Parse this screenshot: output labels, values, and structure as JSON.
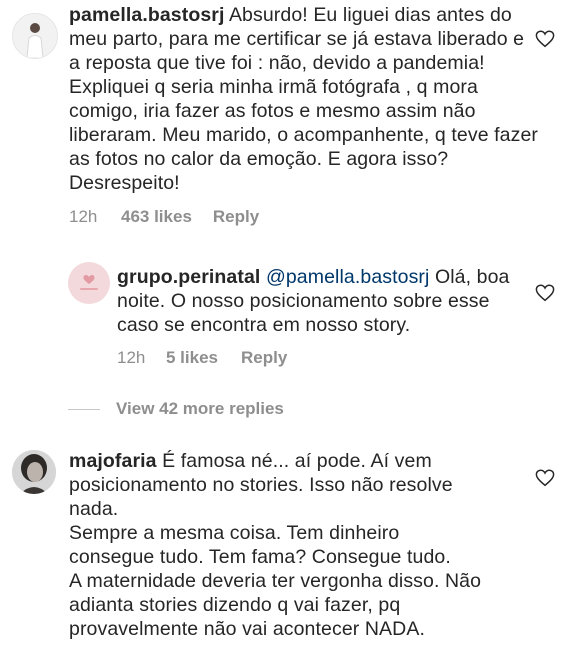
{
  "comments": [
    {
      "username": "pamella.bastosrj",
      "text": "Absurdo! Eu liguei dias antes do meu parto, para me certificar se já estava liberado e a reposta que tive foi : não, devido a pandemia! Expliquei q seria minha irmã fotógrafa , q mora comigo, iria fazer as fotos e mesmo assim não liberaram. Meu marido, o acompanhente, q teve fazer as fotos no calor da emoção. E agora isso? Desrespeito!",
      "time": "12h",
      "likes": "463 likes",
      "reply": "Reply"
    },
    {
      "username": "grupo.perinatal",
      "mention": "@pamella.bastosrj",
      "text": "Olá, boa noite. O nosso posicionamento sobre esse caso se encontra em nosso story.",
      "time": "12h",
      "likes": "5 likes",
      "reply": "Reply"
    },
    {
      "username": "majofaria",
      "text": "É famosa né... aí pode. Aí vem posicionamento no stories. Isso não resolve nada.",
      "text2": "Sempre a mesma coisa. Tem dinheiro consegue tudo. Tem fama? Consegue tudo.",
      "text3": "A maternidade deveria ter vergonha disso. Não adianta stories dizendo q vai fazer, pq provavelmente não vai acontecer NADA."
    }
  ],
  "view_more": "View 42 more replies",
  "colors": {
    "text": "#262626",
    "meta": "#8e8e8e",
    "mention": "#00376b",
    "logo_pink": "#e8a6ad"
  },
  "icons": {
    "like": "heart-outline-icon"
  }
}
